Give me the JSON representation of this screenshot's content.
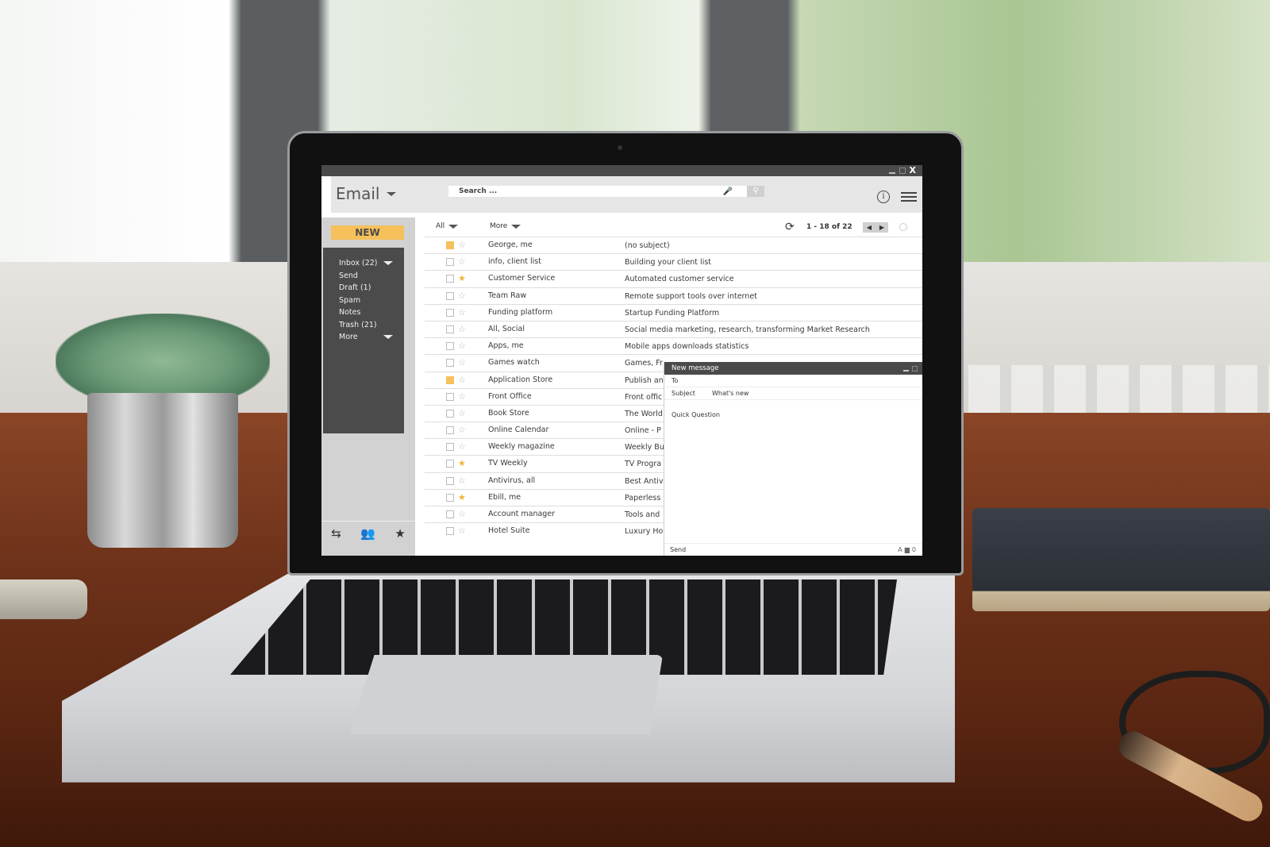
{
  "window": {
    "minimize_icon": "minimize-icon",
    "maximize_icon": "maximize-icon",
    "close_label": "X"
  },
  "header": {
    "app_title": "Email",
    "search_placeholder": "Search ...",
    "mic_icon": "🎤",
    "search_icon": "⚲",
    "info_icon": "i"
  },
  "sidebar": {
    "new_button": "NEW",
    "folders": [
      {
        "label": "Inbox (22)",
        "has_caret": true
      },
      {
        "label": "Send"
      },
      {
        "label": "Draft (1)"
      },
      {
        "label": "Spam"
      },
      {
        "label": "Notes"
      },
      {
        "label": "Trash (21)"
      },
      {
        "label": "More",
        "has_caret": true
      }
    ],
    "footer_icons": {
      "swap": "⇆",
      "contacts": "👥",
      "favorites": "★"
    }
  },
  "toolbar": {
    "select_all": "All",
    "more": "More",
    "refresh_icon": "⟳",
    "pager": "1 - 18 of 22",
    "prev_icon": "◀",
    "next_icon": "▶"
  },
  "emails": [
    {
      "sender": "George, me",
      "subject": "(no subject)",
      "flagged": true,
      "starred": false
    },
    {
      "sender": "info, client list",
      "subject": "Building your client list",
      "flagged": false,
      "starred": false
    },
    {
      "sender": "Customer Service",
      "subject": "Automated customer service",
      "flagged": false,
      "starred": true
    },
    {
      "sender": "Team Raw",
      "subject": "Remote support tools over internet",
      "flagged": false,
      "starred": false
    },
    {
      "sender": "Funding platform",
      "subject": "Startup Funding Platform",
      "flagged": false,
      "starred": false
    },
    {
      "sender": "All, Social",
      "subject": "Social media marketing, research, transforming Market Research",
      "flagged": false,
      "starred": false
    },
    {
      "sender": "Apps, me",
      "subject": "Mobile apps downloads statistics",
      "flagged": false,
      "starred": false
    },
    {
      "sender": "Games watch",
      "subject": "Games, Fr",
      "flagged": false,
      "starred": false
    },
    {
      "sender": "Application Store",
      "subject": "Publish an",
      "flagged": true,
      "starred": false
    },
    {
      "sender": "Front Office",
      "subject": "Front offic",
      "flagged": false,
      "starred": false
    },
    {
      "sender": "Book Store",
      "subject": "The World",
      "flagged": false,
      "starred": false
    },
    {
      "sender": "Online Calendar",
      "subject": "Online - P",
      "flagged": false,
      "starred": false
    },
    {
      "sender": "Weekly magazine",
      "subject": "Weekly Bu",
      "flagged": false,
      "starred": false
    },
    {
      "sender": "TV Weekly",
      "subject": "TV Progra",
      "flagged": false,
      "starred": true
    },
    {
      "sender": "Antivirus, all",
      "subject": "Best Antiv",
      "flagged": false,
      "starred": false
    },
    {
      "sender": "Ebill, me",
      "subject": "Paperless",
      "flagged": false,
      "starred": true
    },
    {
      "sender": "Account manager",
      "subject": "Tools and",
      "flagged": false,
      "starred": false
    },
    {
      "sender": "Hotel Suite",
      "subject": "Luxury Ho",
      "flagged": false,
      "starred": false
    }
  ],
  "compose": {
    "title": "New message",
    "to_label": "To",
    "to_value": "",
    "subject_label": "Subject",
    "subject_value": "What's new",
    "body": "Quick Question",
    "send_label": "Send",
    "format_icon": "A",
    "image_icon": "▆",
    "attach_icon": "0"
  },
  "colors": {
    "accent": "#f6c15a",
    "star_on": "#f3b43a",
    "dark_panel": "#4b4b4b",
    "header_bg": "#e6e6e6"
  }
}
